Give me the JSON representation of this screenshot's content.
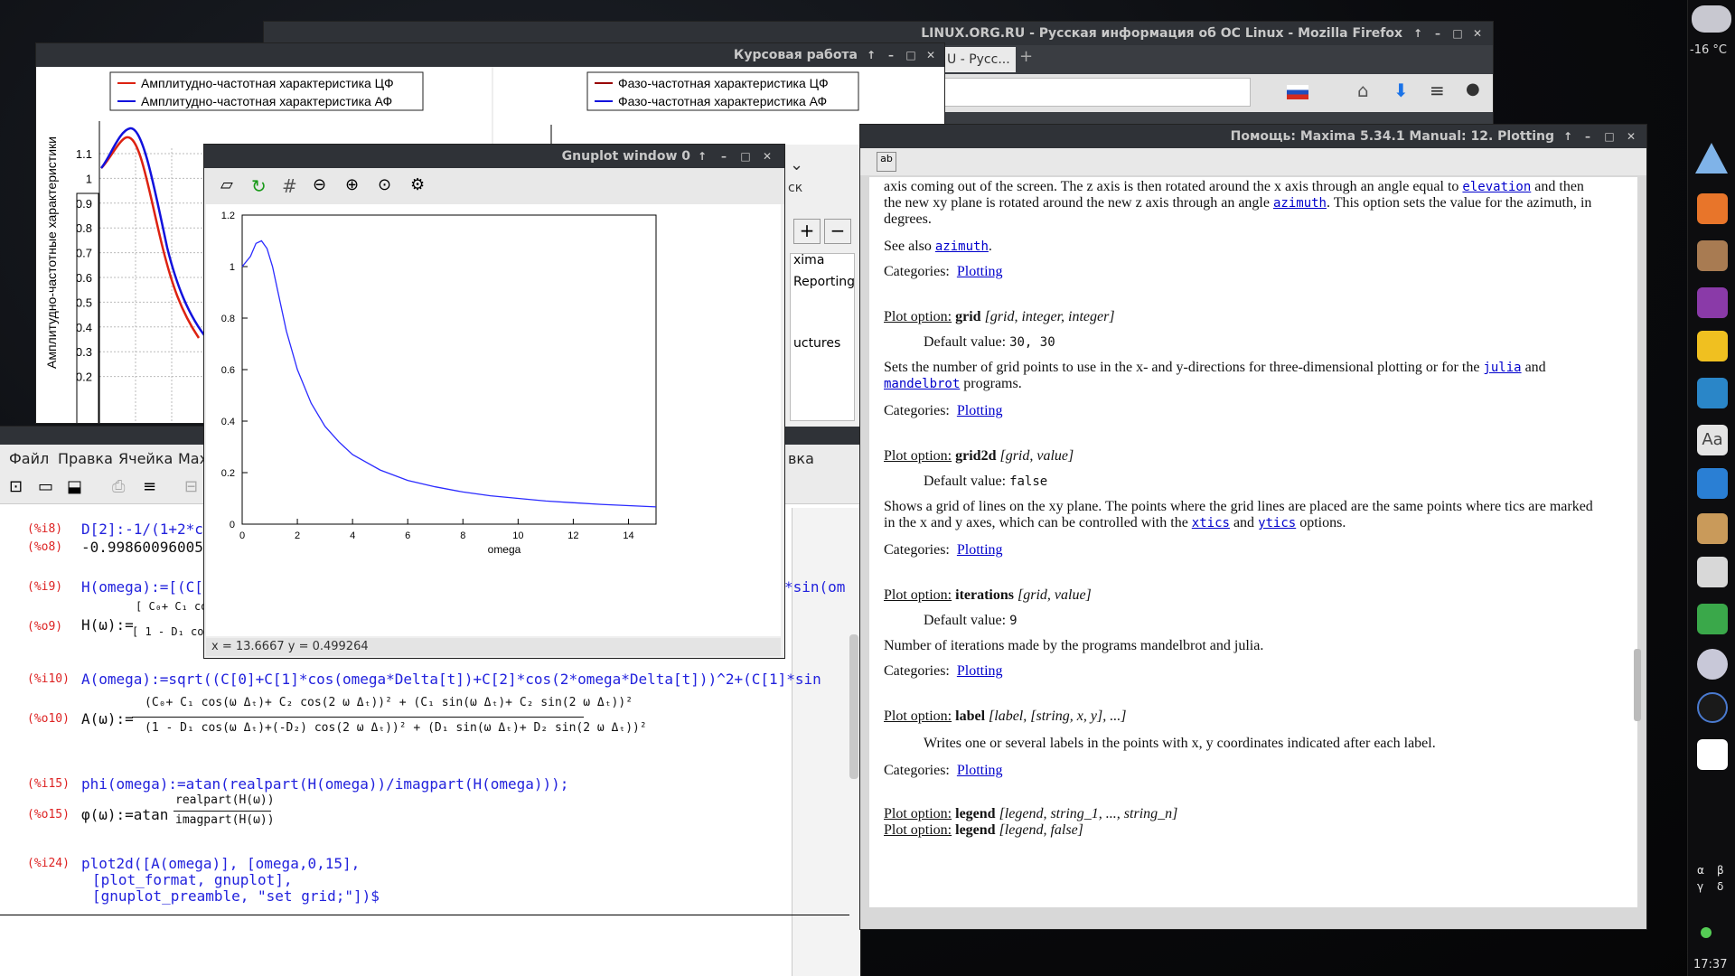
{
  "firefox": {
    "title": "LINUX.ORG.RU - Русская информация об ОС Linux - Mozilla Firefox",
    "tab": "U - Русс..."
  },
  "kurs": {
    "title": "Курсовая работа",
    "legend_left": [
      "Амплитудно-частотная характеристика ЦФ",
      "Амплитудно-частотная характеристика АФ"
    ],
    "legend_right": [
      "Фазо-частотная характеристика ЦФ",
      "Фазо-частотная характеристика АФ"
    ],
    "ylabel": "Амплитудно-частотные характеристики",
    "yticks": [
      "1.1",
      "1",
      "0.9",
      "0.8",
      "0.7",
      "0.6",
      "0.5",
      "0.4",
      "0.3",
      "0.2"
    ],
    "right_tick": "0"
  },
  "maxima": {
    "menu": [
      "Файл",
      "Правка",
      "Ячейка",
      "Мах"
    ],
    "side_items": [
      "xima",
      "Reporting",
      "uctures"
    ],
    "side_tab": "ск",
    "menu_extra": "вка",
    "cells": [
      {
        "lab": "(%i8)",
        "text": "D[2]:-1/(1+2*c"
      },
      {
        "lab": "(%o8)",
        "text": "-0.99860096005"
      },
      {
        "lab": "(%i9)",
        "text": "H(omega):=[(C["
      },
      {
        "lab": "(%o9)",
        "text": "H(ω):="
      },
      {
        "lab": "(%i10)",
        "text": "A(omega):=sqrt((C[0]+C[1]*cos(omega*Delta[t])+C[2]*cos(2*omega*Delta[t]))^2+(C[1]*sin"
      },
      {
        "lab": "(%o10)",
        "text": "A(ω):="
      },
      {
        "lab": "(%i15)",
        "text": "phi(omega):=atan(realpart(H(omega))/imagpart(H(omega)));"
      },
      {
        "lab": "(%o15)",
        "text": "φ(ω):=atan"
      },
      {
        "lab": "(%i24)",
        "text": "plot2d([A(omega)], [omega,0,15],"
      }
    ],
    "input2": "[plot_format, gnuplot],",
    "input3": "[gnuplot_preamble, \"set grid;\"])$",
    "frac_realpart": "realpart(H(ω))",
    "frac_imagpart": "imagpart(H(ω))",
    "sin_tail": "*sin(om",
    "o9_num": "[ C₀+ C₁ cos",
    "o9_den": "[ 1 - D₁ cos(",
    "o10_num": "(C₀+ C₁ cos(ω Δₜ)+ C₂ cos(2 ω Δₜ))² + (C₁ sin(ω Δₜ)+ C₂ sin(2 ω Δₜ))²",
    "o10_den": "(1 - D₁ cos(ω Δₜ)+(-D₂) cos(2 ω Δₜ))² + (D₁ sin(ω Δₜ)+ D₂ sin(2 ω Δₜ))²"
  },
  "gnuplot": {
    "title": "Gnuplot window 0",
    "status": "x = 13.6667 y = 0.499264"
  },
  "help": {
    "title": "Помощь: Maxima 5.34.1 Manual: 12. Plotting",
    "p1a": "axis coming out of the screen. The z axis is then rotated around the x axis through an angle equal to",
    "p1link": "elevation",
    "p1b": "and then",
    "p2a": "the new xy plane is rotated around the new z axis through an angle",
    "p2link": "azimuth",
    "p2b": ". This option sets the value for the azimuth, in",
    "p3": "degrees.",
    "see_also": "See also",
    "see_link": "azimuth",
    "categories": "Categories:",
    "cat_link": "Plotting",
    "opt_label": "Plot option:",
    "grid": {
      "name": "grid",
      "sig": "[grid, integer, integer]",
      "default_label": "Default value:",
      "default": "30, 30",
      "desc1": "Sets the number of grid points to use in the x- and y-directions for three-dimensional plotting or for the",
      "link1": "julia",
      "and": "and",
      "link2": "mandelbrot",
      "desc2": "programs."
    },
    "grid2d": {
      "name": "grid2d",
      "sig": "[grid, value]",
      "default": "false",
      "desc1": "Shows a grid of lines on the xy plane. The points where the grid lines are placed are the same points where tics are marked",
      "desc2a": "in the x and y axes, which can be controlled with the",
      "l1": "xtics",
      "and": "and",
      "l2": "ytics",
      "desc2b": "options."
    },
    "iterations": {
      "name": "iterations",
      "sig": "[grid, value]",
      "default": "9",
      "desc": "Number of iterations made by the programs mandelbrot and julia."
    },
    "label": {
      "name": "label",
      "sig": "[label, [string, x, y], ...]",
      "desc": "Writes one or several labels in the points with x, y coordinates indicated after each label."
    },
    "legend1": {
      "name": "legend",
      "sig": "[legend, string_1, ..., string_n]"
    },
    "legend2": {
      "name": "legend",
      "sig": "[legend, false]"
    }
  },
  "panel": {
    "temp": "-16 °C",
    "time": "17:37",
    "letters": [
      "α",
      "β",
      "γ",
      "δ"
    ]
  },
  "chart_data": {
    "type": "line",
    "title": "",
    "xlabel": "omega",
    "ylabel": "",
    "xlim": [
      0,
      15
    ],
    "ylim": [
      0,
      1.2
    ],
    "xticks": [
      "0",
      "2",
      "4",
      "6",
      "8",
      "10",
      "12",
      "14"
    ],
    "yticks": [
      "0",
      "0.2",
      "0.4",
      "0.6",
      "0.8",
      "1",
      "1.2"
    ],
    "series": [
      {
        "color": "#2b2bff",
        "x": [
          0,
          0.3,
          0.5,
          0.7,
          0.9,
          1.1,
          1.3,
          1.6,
          2,
          2.5,
          3,
          3.5,
          4,
          5,
          6,
          7,
          8,
          9,
          10,
          11,
          12,
          13,
          14,
          15
        ],
        "y": [
          1.0,
          1.04,
          1.09,
          1.1,
          1.07,
          1.0,
          0.9,
          0.75,
          0.6,
          0.47,
          0.38,
          0.32,
          0.27,
          0.21,
          0.17,
          0.145,
          0.125,
          0.11,
          0.1,
          0.09,
          0.083,
          0.077,
          0.072,
          0.067
        ]
      }
    ]
  }
}
